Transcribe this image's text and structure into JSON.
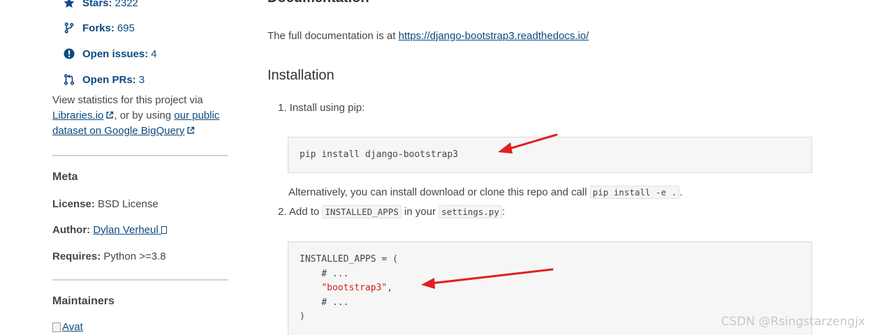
{
  "sidebar": {
    "stats": [
      {
        "icon": "star-icon",
        "label": "Stars:",
        "value": "2322"
      },
      {
        "icon": "fork-icon",
        "label": "Forks:",
        "value": "695"
      },
      {
        "icon": "issue-icon",
        "label": "Open issues:",
        "value": "4"
      },
      {
        "icon": "pull-request-icon",
        "label": "Open PRs:",
        "value": "3"
      }
    ],
    "stats_text_prefix": "View statistics for this project via",
    "stats_link_1": "Libraries.io",
    "stats_text_mid": ", or by using",
    "stats_link_2": "our public dataset on Google BigQuery",
    "meta": {
      "heading": "Meta",
      "license_label": "License:",
      "license_value": "BSD License",
      "author_label": "Author:",
      "author_value": "Dylan Verheul",
      "requires_label": "Requires:",
      "requires_value": "Python >=3.8"
    },
    "maintainers": {
      "heading": "Maintainers",
      "avatar_alt": "Avat"
    }
  },
  "main": {
    "doc_heading": "Documentation",
    "doc_text": "The full documentation is at",
    "doc_link": "https://django-bootstrap3.readthedocs.io/",
    "install_heading": "Installation",
    "step1": "1. Install using pip:",
    "code1": "pip install django-bootstrap3",
    "alt_text_1": "Alternatively, you can install download or clone this repo and call",
    "alt_code": "pip install -e .",
    "alt_text_2": ".",
    "step2_prefix": "2. Add to",
    "step2_code1": "INSTALLED_APPS",
    "step2_mid": "in your",
    "step2_code2": "settings.py",
    "step2_suffix": ":",
    "code2": {
      "line1": "INSTALLED_APPS = (",
      "line2": "    # ...",
      "line3_indent": "    ",
      "line3_str": "\"bootstrap3\"",
      "line3_end": ",",
      "line4": "    # ...",
      "line5": ")"
    }
  },
  "watermark": "CSDN @Rsingstarzengjx",
  "colors": {
    "link": "#0c4a80",
    "annotation_arrow": "#e02020",
    "code_string": "#d12121"
  }
}
